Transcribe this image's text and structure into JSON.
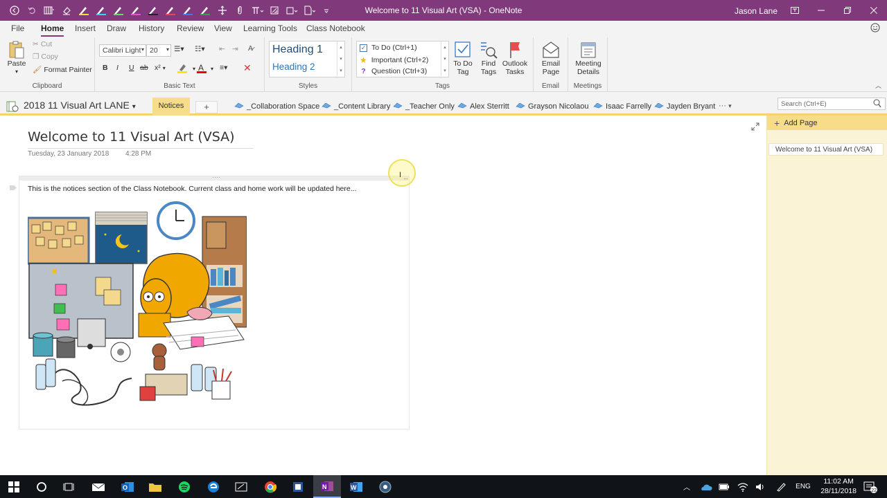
{
  "window": {
    "title": "Welcome to 11 Visual Art (VSA)  -  OneNote",
    "user": "Jason Lane"
  },
  "menu_tabs": [
    "File",
    "Home",
    "Insert",
    "Draw",
    "History",
    "Review",
    "View",
    "Learning Tools",
    "Class Notebook"
  ],
  "active_tab": "Home",
  "ribbon": {
    "clipboard": {
      "paste": "Paste",
      "cut": "Cut",
      "copy": "Copy",
      "format_painter": "Format Painter",
      "label": "Clipboard"
    },
    "basic_text": {
      "font": "Calibri Light",
      "size": "20",
      "bold": "B",
      "italic": "I",
      "underline": "U",
      "strike": "ab",
      "superscript": "x²",
      "label": "Basic Text"
    },
    "styles": {
      "heading1": "Heading 1",
      "heading2": "Heading 2",
      "label": "Styles"
    },
    "tags": {
      "todo": "To Do (Ctrl+1)",
      "important": "Important (Ctrl+2)",
      "question": "Question (Ctrl+3)",
      "todo_tag": "To Do Tag",
      "find_tags": "Find Tags",
      "outlook_tasks": "Outlook Tasks",
      "label": "Tags"
    },
    "email": {
      "button": "Email Page",
      "label": "Email"
    },
    "meetings": {
      "button": "Meeting Details",
      "label": "Meetings"
    }
  },
  "notebook": {
    "name": "2018 11 Visual Art LANE",
    "active_section": "Notices",
    "add_section": "+"
  },
  "sections": [
    "_Collaboration Space",
    "_Content Library",
    "_Teacher Only",
    "Alex Sterritt",
    "Grayson Nicolaou",
    "Isaac Farrelly",
    "Jayden Bryant"
  ],
  "more_sections": "···",
  "search": {
    "placeholder": "Search (Ctrl+E)"
  },
  "page": {
    "title": "Welcome to 11 Visual Art (VSA)",
    "date": "Tuesday, 23 January 2018",
    "time": "4:28 PM",
    "notice": "This is the notices section of the Class Notebook. Current class and home work will be updated here..."
  },
  "pages_panel": {
    "add_page": "Add Page",
    "pages": [
      "Welcome to 11 Visual Art (VSA)"
    ]
  },
  "taskbar": {
    "time": "11:02 AM",
    "date": "28/11/2018",
    "lang": "ENG",
    "notifications": "22"
  },
  "colors": {
    "brand": "#80397b",
    "section_tab": "#f7dd89",
    "pages_bg": "#fbf3d5"
  }
}
